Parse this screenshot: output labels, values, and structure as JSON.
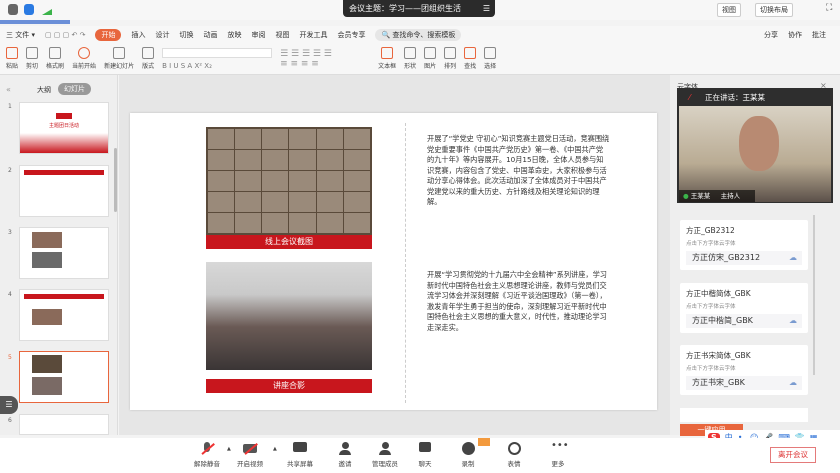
{
  "window": {
    "title": "会议主题：学习——团组织生活",
    "view_label": "视图",
    "layout_label": "切换布局"
  },
  "menu": {
    "file": "三 文件 ▾",
    "tabs": [
      "开始",
      "插入",
      "设计",
      "切换",
      "动画",
      "放映",
      "审阅",
      "视图",
      "开发工具",
      "会员专享"
    ],
    "search": "查找命令、搜索模板",
    "right": [
      "分享",
      "协作",
      "批注"
    ]
  },
  "ribbon": {
    "items": [
      "粘贴",
      "剪切",
      "格式刷",
      "当前开始",
      "新建幻灯片",
      "版式",
      "文本框",
      "形状",
      "图片",
      "排列",
      "查找",
      "选择"
    ]
  },
  "left_panel": {
    "tabs": [
      "大纲",
      "幻灯片"
    ],
    "slide_numbers": [
      "1",
      "2",
      "3",
      "4",
      "5",
      "6"
    ],
    "selected": 5,
    "cover_title": "主题团日活动"
  },
  "slide": {
    "caption1": "线上会议截图",
    "caption2": "讲座合影",
    "text1": "开展了“学党史 守初心”知识竞赛主题党日活动，竞赛围绕党史重要事件《中国共产党历史》第一卷、《中国共产党的九十年》等内容展开。10月15日晚，全体人员参与知识竞赛，内容包含了党史、中国革命史，大家积极参与活动分享心得体会。此次活动加深了全体成员对于中国共产党建党以来的重大历史、方针路线及相关理论知识的理解。",
    "text2": "开展“学习贯彻党的十九届六中全会精神”系列讲座，学习新时代中国特色社会主义思想理论讲座，教师与党员们交流学习体会并深刻理解《习近平谈治国理政》（第一卷），激发青年学生勇于担当的使命，深刻理解习近平新时代中国特色社会主义思想的重大意义，时代性，推动理论学习走深走实。"
  },
  "right_panel": {
    "title": "云字体",
    "video": {
      "status": "正在讲话：王某某",
      "name": "王某某",
      "label": "主持人"
    },
    "fonts": [
      {
        "name": "方正_GB2312",
        "note": "点击下方字体云字体",
        "preview": "方正仿宋_GB2312"
      },
      {
        "name": "方正中楷简体_GBK",
        "note": "点击下方字体云字体",
        "preview": "方正中楷简_GBK"
      },
      {
        "name": "方正书宋简体_GBK",
        "note": "点击下方字体云字体",
        "preview": "方正书宋_GBK"
      }
    ],
    "apply_button": "一键应用"
  },
  "toolbar": [
    {
      "label": "解除静音",
      "icon": "mic-muted-icon"
    },
    {
      "label": "开启视频",
      "icon": "camera-off-icon"
    },
    {
      "label": "共享屏幕",
      "icon": "share-screen-icon"
    },
    {
      "label": "邀请",
      "icon": "invite-icon"
    },
    {
      "label": "管理成员",
      "icon": "members-icon"
    },
    {
      "label": "聊天",
      "icon": "chat-icon"
    },
    {
      "label": "录制",
      "icon": "record-icon"
    },
    {
      "label": "表情",
      "icon": "emoji-icon"
    },
    {
      "label": "更多",
      "icon": "more-icon"
    }
  ],
  "leave_button": "离开会议",
  "ime": {
    "label": "中"
  },
  "colors": {
    "accent": "#e8663d",
    "party_red": "#c8161d",
    "leave": "#d33333"
  }
}
